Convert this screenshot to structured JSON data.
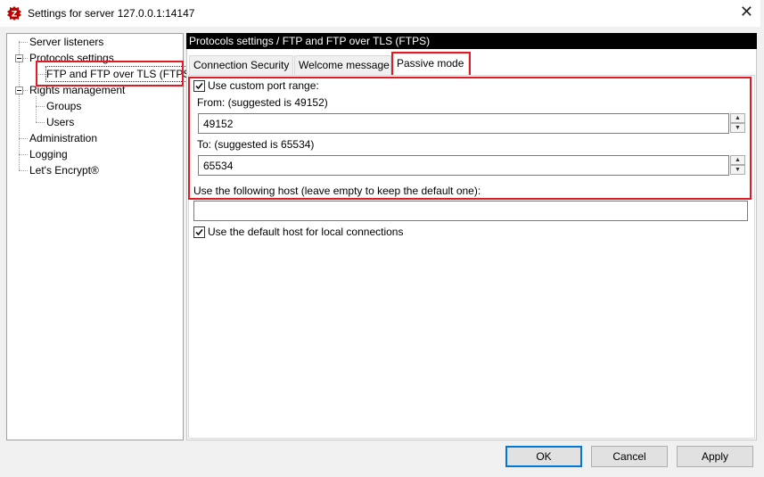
{
  "window": {
    "title": "Settings for server 127.0.0.1:14147",
    "close_glyph": "✕",
    "app_icon": "filezilla-icon"
  },
  "tree": {
    "items": [
      {
        "label": "Server listeners"
      },
      {
        "label": "Protocols settings"
      },
      {
        "label": "FTP and FTP over TLS (FTPS)"
      },
      {
        "label": "Rights management"
      },
      {
        "label": "Groups"
      },
      {
        "label": "Users"
      },
      {
        "label": "Administration"
      },
      {
        "label": "Logging"
      },
      {
        "label": "Let's Encrypt®"
      }
    ]
  },
  "panel": {
    "header": "Protocols settings / FTP and FTP over TLS (FTPS)",
    "tabs": [
      {
        "label": "Connection Security"
      },
      {
        "label": "Welcome message"
      },
      {
        "label": "Passive mode"
      }
    ],
    "active_tab": "Passive mode"
  },
  "passive": {
    "use_custom_range_label": "Use custom port range:",
    "use_custom_range_checked": true,
    "from_label": "From: (suggested is 49152)",
    "from_value": "49152",
    "to_label": "To: (suggested is 65534)",
    "to_value": "65534",
    "host_label": "Use the following host (leave empty to keep the default one):",
    "host_value": "",
    "default_host_local_label": "Use the default host for local connections",
    "default_host_local_checked": true
  },
  "buttons": {
    "ok": "OK",
    "cancel": "Cancel",
    "apply": "Apply"
  },
  "colors": {
    "highlight": "#e01b24",
    "header_bg": "#000000",
    "default_button_border": "#0078d7"
  }
}
